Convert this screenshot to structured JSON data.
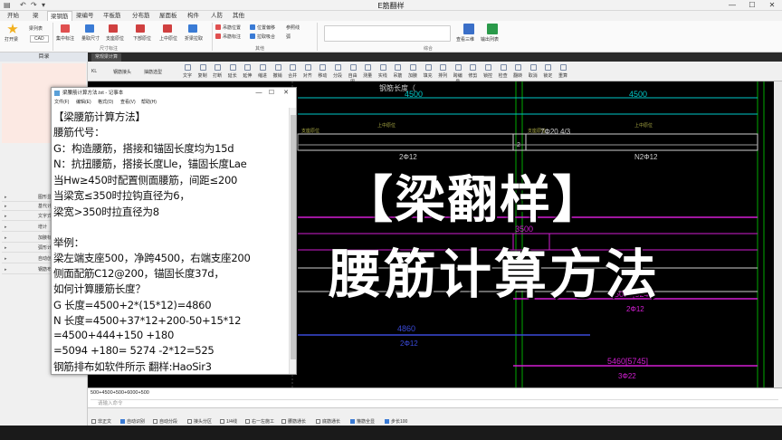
{
  "app": {
    "title": "E筋翻样"
  },
  "menu_tabs": [
    "开始",
    "梁",
    "梁钢筋",
    "梁编号",
    "平板筋",
    "分布筋",
    "屋面板",
    "构件",
    "人防",
    "其他"
  ],
  "ribbon": {
    "big_button": "打开梁",
    "groups": [
      "尺寸标注",
      "其他",
      "综合"
    ],
    "items": [
      "梁列表",
      "CAD",
      "集中标注",
      "量取尺寸",
      "支座原位",
      "下部原位",
      "上中原位",
      "折梁拉取",
      "吊筋位置",
      "吊筋标注",
      "位置偏移",
      "拉取吸合",
      "参照线",
      "弧",
      "查看三维",
      "输出列表"
    ]
  },
  "left_panel": {
    "header": "目录",
    "items": [
      "图形显",
      "基代计",
      "文字式",
      "增计",
      "加腋标准",
      "弧形计",
      "自动创",
      "钢筋布"
    ]
  },
  "cad": {
    "tab": "常规梁计算",
    "layer": "KL",
    "dropdown1": "钢筋接头",
    "dropdown2": "抽筋选型",
    "tools": [
      "文字",
      "复制",
      "打断",
      "延长",
      "延伸",
      "缩进",
      "撤销",
      "合并",
      "对齐",
      "移动",
      "分段",
      "自由图",
      "测量",
      "实线",
      "吊筋",
      "加腋",
      "填充",
      "排列",
      "跨编号",
      "修剪",
      "锁控",
      "检查",
      "翻转",
      "取消",
      "锁定",
      "重算"
    ]
  },
  "drawing": {
    "top_label": "钢筋长度（",
    "dims": [
      "4500",
      "4500"
    ],
    "labels": [
      "支座原位",
      "上中原位",
      "支座原位",
      "上中原位",
      "2Φ12",
      "N2Φ12",
      "7Φ20 4/3",
      "3500",
      "2",
      "4860",
      "2Φ12",
      "5090[5245]",
      "2Φ12",
      "5460[5745]",
      "3Φ22"
    ]
  },
  "notepad": {
    "title": "梁腰筋计算方法.txt - 记事本",
    "menu": [
      "文件(F)",
      "编辑(E)",
      "格式(O)",
      "查看(V)",
      "帮助(H)"
    ],
    "lines": [
      "【梁腰筋计算方法】",
      "腰筋代号：",
      "G：构造腰筋，搭接和锚固长度均为15d",
      "N：抗扭腰筋，搭接长度Lle，锚固长度Lae",
      "当Hw≥450时配置侧面腰筋，间距≤200",
      "当梁宽≤350时拉钩直径为6，",
      "梁宽>350时拉直径为8",
      "",
      "举例：",
      "梁左端支座500，净跨4500，右端支座200",
      "侧面配筋C12@200，锚固长度37d，",
      "如何计算腰筋长度？",
      "G 长度=4500+2*(15*12)=4860",
      "N 长度=4500+37*12+200-50+15*12",
      "         =4500+444+150 +180",
      "         =5094 +180= 5274 -2*12=525",
      "钢筋排布如软件所示   翻样:HaoSir3"
    ]
  },
  "overlay": {
    "line1": "【梁翻样】",
    "line2": "腰筋计算方法"
  },
  "cmd": {
    "output": "500+4500+500+6000+500",
    "prompt": "请输入命令"
  },
  "status": [
    "自动识别",
    "自动分段",
    "接头分区",
    "1/4线",
    "右一左施工",
    "腰筋通长",
    "底筋通长",
    "箍筋全显",
    "步长100"
  ],
  "status_first": "非正文",
  "colors": {
    "accent": "#2b5fb3",
    "dim": "#00c8c8",
    "magenta": "#d21ed2",
    "beam_blue": "#3a4ad8",
    "canvas": "#000000"
  }
}
